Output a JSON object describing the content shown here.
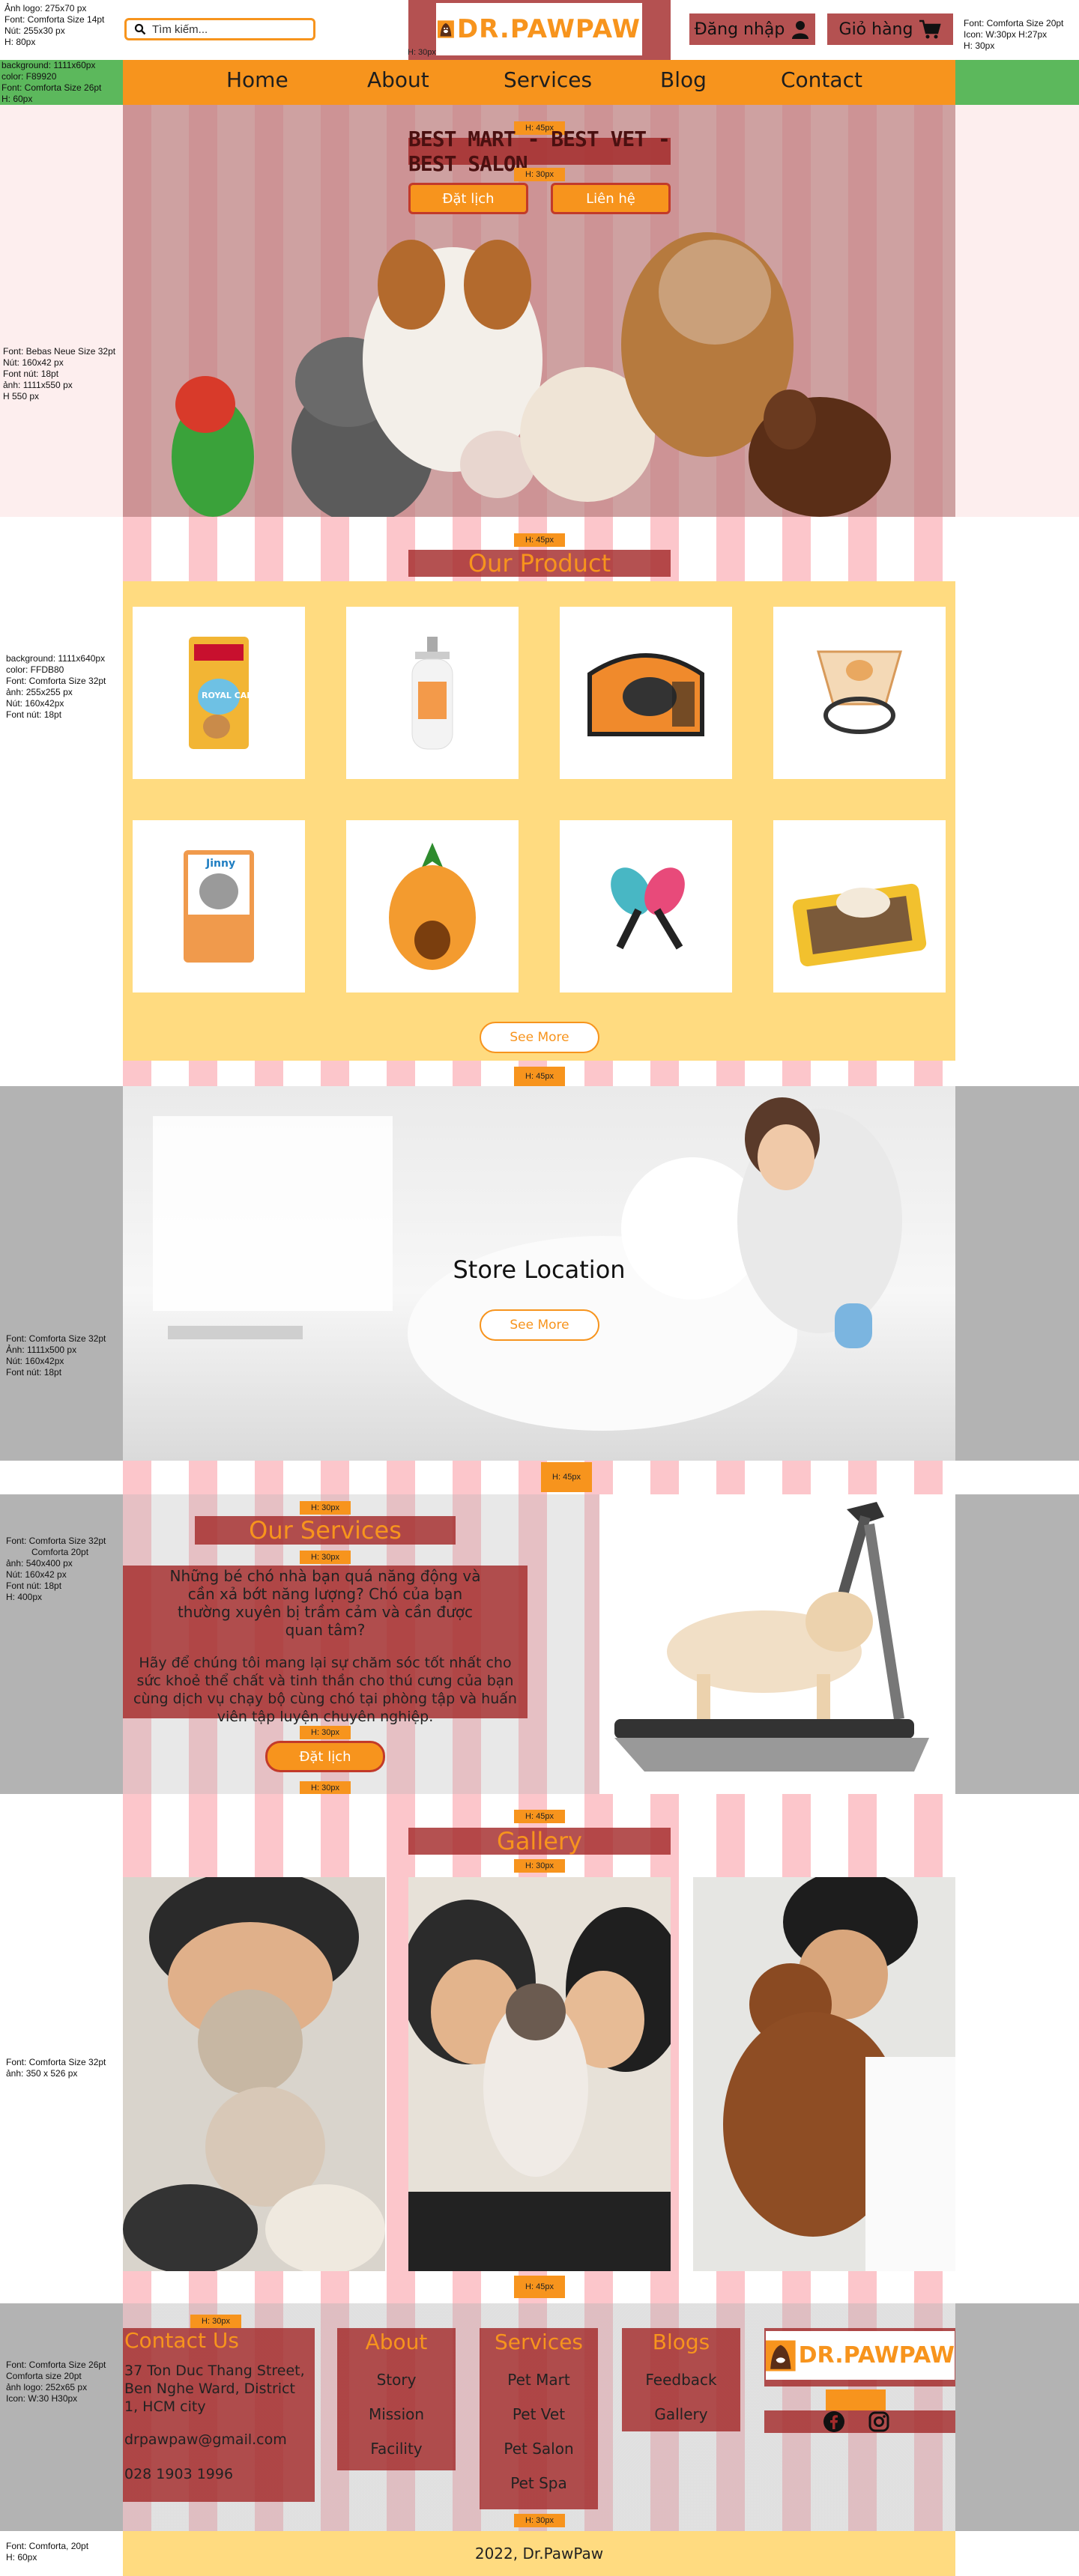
{
  "specs": {
    "logo_spec": [
      "Ảnh logo: 275x70 px",
      "Font: Comforta Size 14pt",
      "Nút: 255x30 px",
      "H: 80px"
    ],
    "cart_spec": [
      "Font: Comforta Size 20pt",
      "Icon: W:30px H:27px",
      "H: 30px"
    ],
    "nav_spec": [
      "background: 1111x60px",
      "color: F89920",
      "Font: Comforta Size 26pt",
      "H: 60px"
    ],
    "hero_spec": [
      "Font: Bebas Neue Size 32pt",
      "Nút: 160x42 px",
      "Font nút: 18pt",
      "ảnh: 1111x550 px",
      "H 550 px"
    ],
    "product_spec": [
      "background: 1111x640px",
      "color: FFDB80",
      "Font: Comforta Size 32pt",
      "ảnh: 255x255 px",
      "Nút: 160x42px",
      "Font nút: 18pt"
    ],
    "store_spec": [
      "Font: Comforta Size 32pt",
      "Ảnh: 1111x500 px",
      "Nút: 160x42px",
      "Font nút: 18pt"
    ],
    "services_spec": [
      "Font: Comforta Size 32pt",
      "Comforta 20pt",
      "ảnh: 540x400 px",
      "Nút: 160x42 px",
      "Font nút: 18pt",
      "H: 400px"
    ],
    "gallery_spec": [
      "Font: Comforta Size 32pt",
      "ảnh: 350 x 526 px"
    ],
    "footer_spec": [
      "Font: Comforta Size 26pt",
      "Comforta size 20pt",
      "ảnh logo: 252x65 px",
      "Icon: W:30 H30px"
    ],
    "copyright_spec": [
      "Font: Comforta, 20pt",
      "H: 60px"
    ]
  },
  "header": {
    "search_placeholder": "Tìm kiếm...",
    "logo_text": "DR.PAWPAW",
    "login_label": "Đăng nhập",
    "cart_label": "Giỏ hàng"
  },
  "nav": {
    "items": [
      "Home",
      "About",
      "Services",
      "Blog",
      "Contact"
    ]
  },
  "hero": {
    "tagline": "BEST MART - BEST VET - BEST SALON",
    "book_label": "Đặt lịch",
    "contact_label": "Liên hệ"
  },
  "heights": {
    "h30": "H: 30px",
    "h45": "H: 45px"
  },
  "products": {
    "title": "Our Product",
    "items": [
      {
        "label": "ROYAL CANIN Poodle",
        "color": "#f2b534"
      },
      {
        "label": "",
        "color": "#f0f0f0"
      },
      {
        "label": "",
        "color": "#f08a2c"
      },
      {
        "label": "",
        "color": "#e9a860"
      },
      {
        "label": "Jinny",
        "color": "#f09a4c"
      },
      {
        "label": "",
        "color": "#f39b2f"
      },
      {
        "label": "",
        "color": "#48b7c4"
      },
      {
        "label": "",
        "color": "#f2c12e"
      }
    ],
    "see_more": "See More"
  },
  "store": {
    "title": "Store Location",
    "see_more": "See More"
  },
  "services": {
    "title": "Our Services",
    "paragraph1": "Những bé chó nhà bạn quá năng động và cần xả bớt năng lượng? Chó của bạn thường xuyên bị trầm cảm và cần được quan tâm?",
    "paragraph2": "Hãy để chúng tôi mang lại sự chăm sóc tốt nhất cho sức khoẻ thể chất và tinh thần cho thú cưng của bạn cùng dịch vụ chạy bộ cùng chó tại phòng tập và huấn viên tập luyện chuyên nghiệp.",
    "book_label": "Đặt lịch"
  },
  "gallery": {
    "title": "Gallery"
  },
  "footer": {
    "contact_title": "Contact Us",
    "address": "37 Ton Duc Thang Street, Ben Nghe Ward, District 1, HCM city",
    "email": "drpawpaw@gmail.com",
    "phone": "028 1903 1996",
    "about_title": "About",
    "about_items": [
      "Story",
      "Mission",
      "Facility"
    ],
    "services_title": "Services",
    "services_items": [
      "Pet Mart",
      "Pet Vet",
      "Pet Salon",
      "Pet Spa"
    ],
    "blogs_title": "Blogs",
    "blogs_items": [
      "Feedback",
      "Gallery"
    ],
    "logo_text": "DR.PAWPAW"
  },
  "copyright": "2022, Dr.PawPaw",
  "colors": {
    "orange": "#f7941d",
    "maroon": "#a32b2b",
    "cream": "#ffdb80",
    "gray": "#b3b3b3",
    "green": "#5cb85c",
    "pink": "#fcc6cb"
  }
}
